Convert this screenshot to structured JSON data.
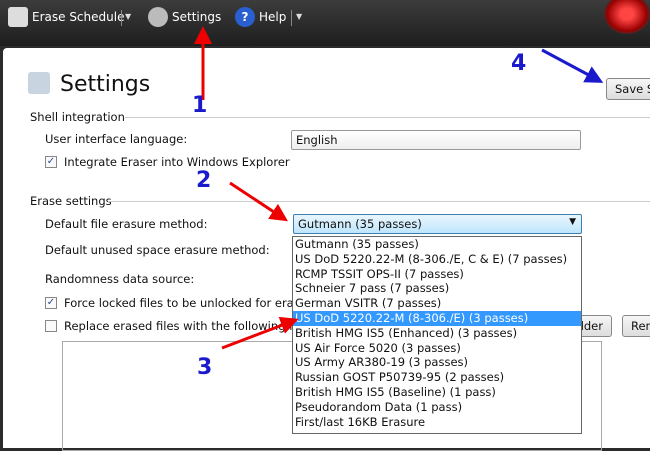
{
  "toolbar": {
    "erase_schedule": "Erase Schedule",
    "settings": "Settings",
    "help": "Help"
  },
  "page": {
    "title": "Settings",
    "save_button": "Save Settings"
  },
  "shell": {
    "group": "Shell integration",
    "language_label": "User interface language:",
    "language_value": "English",
    "integrate_label": "Integrate Eraser into Windows Explorer",
    "integrate_checked": true
  },
  "erase": {
    "group": "Erase settings",
    "file_method_label": "Default file erasure method:",
    "file_method_value": "Gutmann (35 passes)",
    "unused_label": "Default unused space erasure method:",
    "random_label": "Randomness data source:",
    "force_label": "Force locked files to be unlocked for erasure",
    "force_checked": true,
    "replace_label": "Replace erased files with the following files",
    "replace_checked": false,
    "add_folder": "Add Folder...",
    "remove": "Remove"
  },
  "dropdown": {
    "selected_index": 5,
    "options": [
      "Gutmann (35 passes)",
      "US DoD 5220.22-M (8-306./E, C & E) (7 passes)",
      "RCMP TSSIT OPS-II (7 passes)",
      "Schneier 7 pass (7 passes)",
      "German VSITR (7 passes)",
      "US DoD 5220.22-M (8-306./E) (3 passes)",
      "British HMG IS5 (Enhanced) (3 passes)",
      "US Air Force 5020 (3 passes)",
      "US Army AR380-19 (3 passes)",
      "Russian GOST P50739-95 (2 passes)",
      "British HMG IS5 (Baseline) (1 pass)",
      "Pseudorandom Data (1 pass)",
      "First/last 16KB Erasure"
    ]
  },
  "annotations": [
    "1",
    "2",
    "3",
    "4"
  ]
}
